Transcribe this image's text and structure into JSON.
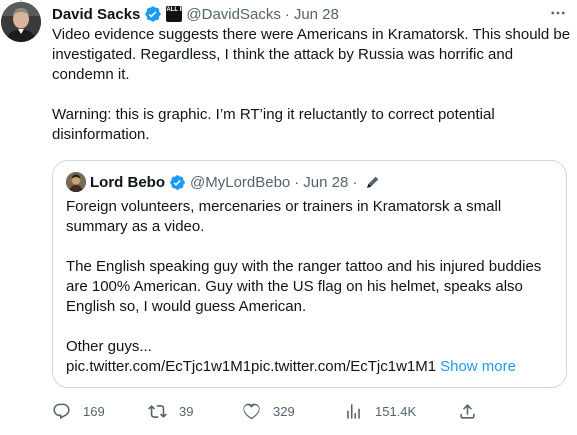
{
  "tweet": {
    "author_name": "David Sacks",
    "affiliate_badge": "ALL IN",
    "handle": "@DavidSacks",
    "separator": "·",
    "date": "Jun 28",
    "more_icon": "more-horizontal-icon",
    "paragraphs": [
      "Video evidence suggests there were Americans in Kramatorsk. This should be investigated. Regardless, I think the attack by Russia was horrific and condemn it.",
      "Warning: this is graphic. I’m RT’ing it reluctantly to correct potential disinformation."
    ]
  },
  "quote": {
    "author_name": "Lord Bebo",
    "handle": "@MyLordBebo",
    "separator": "·",
    "date": "Jun 28",
    "separator2": "·",
    "paragraphs": [
      "Foreign volunteers, mercenaries or trainers in Kramatorsk a small summary as a video.",
      "The English speaking guy with the ranger tattoo and his injured buddies are 100% American. Guy with the US flag on his helmet, speaks also English so, I would guess American."
    ],
    "last_line": "Other guys...",
    "link_text": "pic.twitter.com/EcTjc1w1M1pic.twitter.com/EcTjc1w1M1",
    "show_more": "Show more"
  },
  "actions": {
    "replies": "169",
    "retweets": "39",
    "likes": "329",
    "views": "151.4K"
  },
  "colors": {
    "verified": "#1d9bf0",
    "link_accent": "#1d9bf0",
    "muted": "#536471",
    "border": "#cfd9de"
  }
}
